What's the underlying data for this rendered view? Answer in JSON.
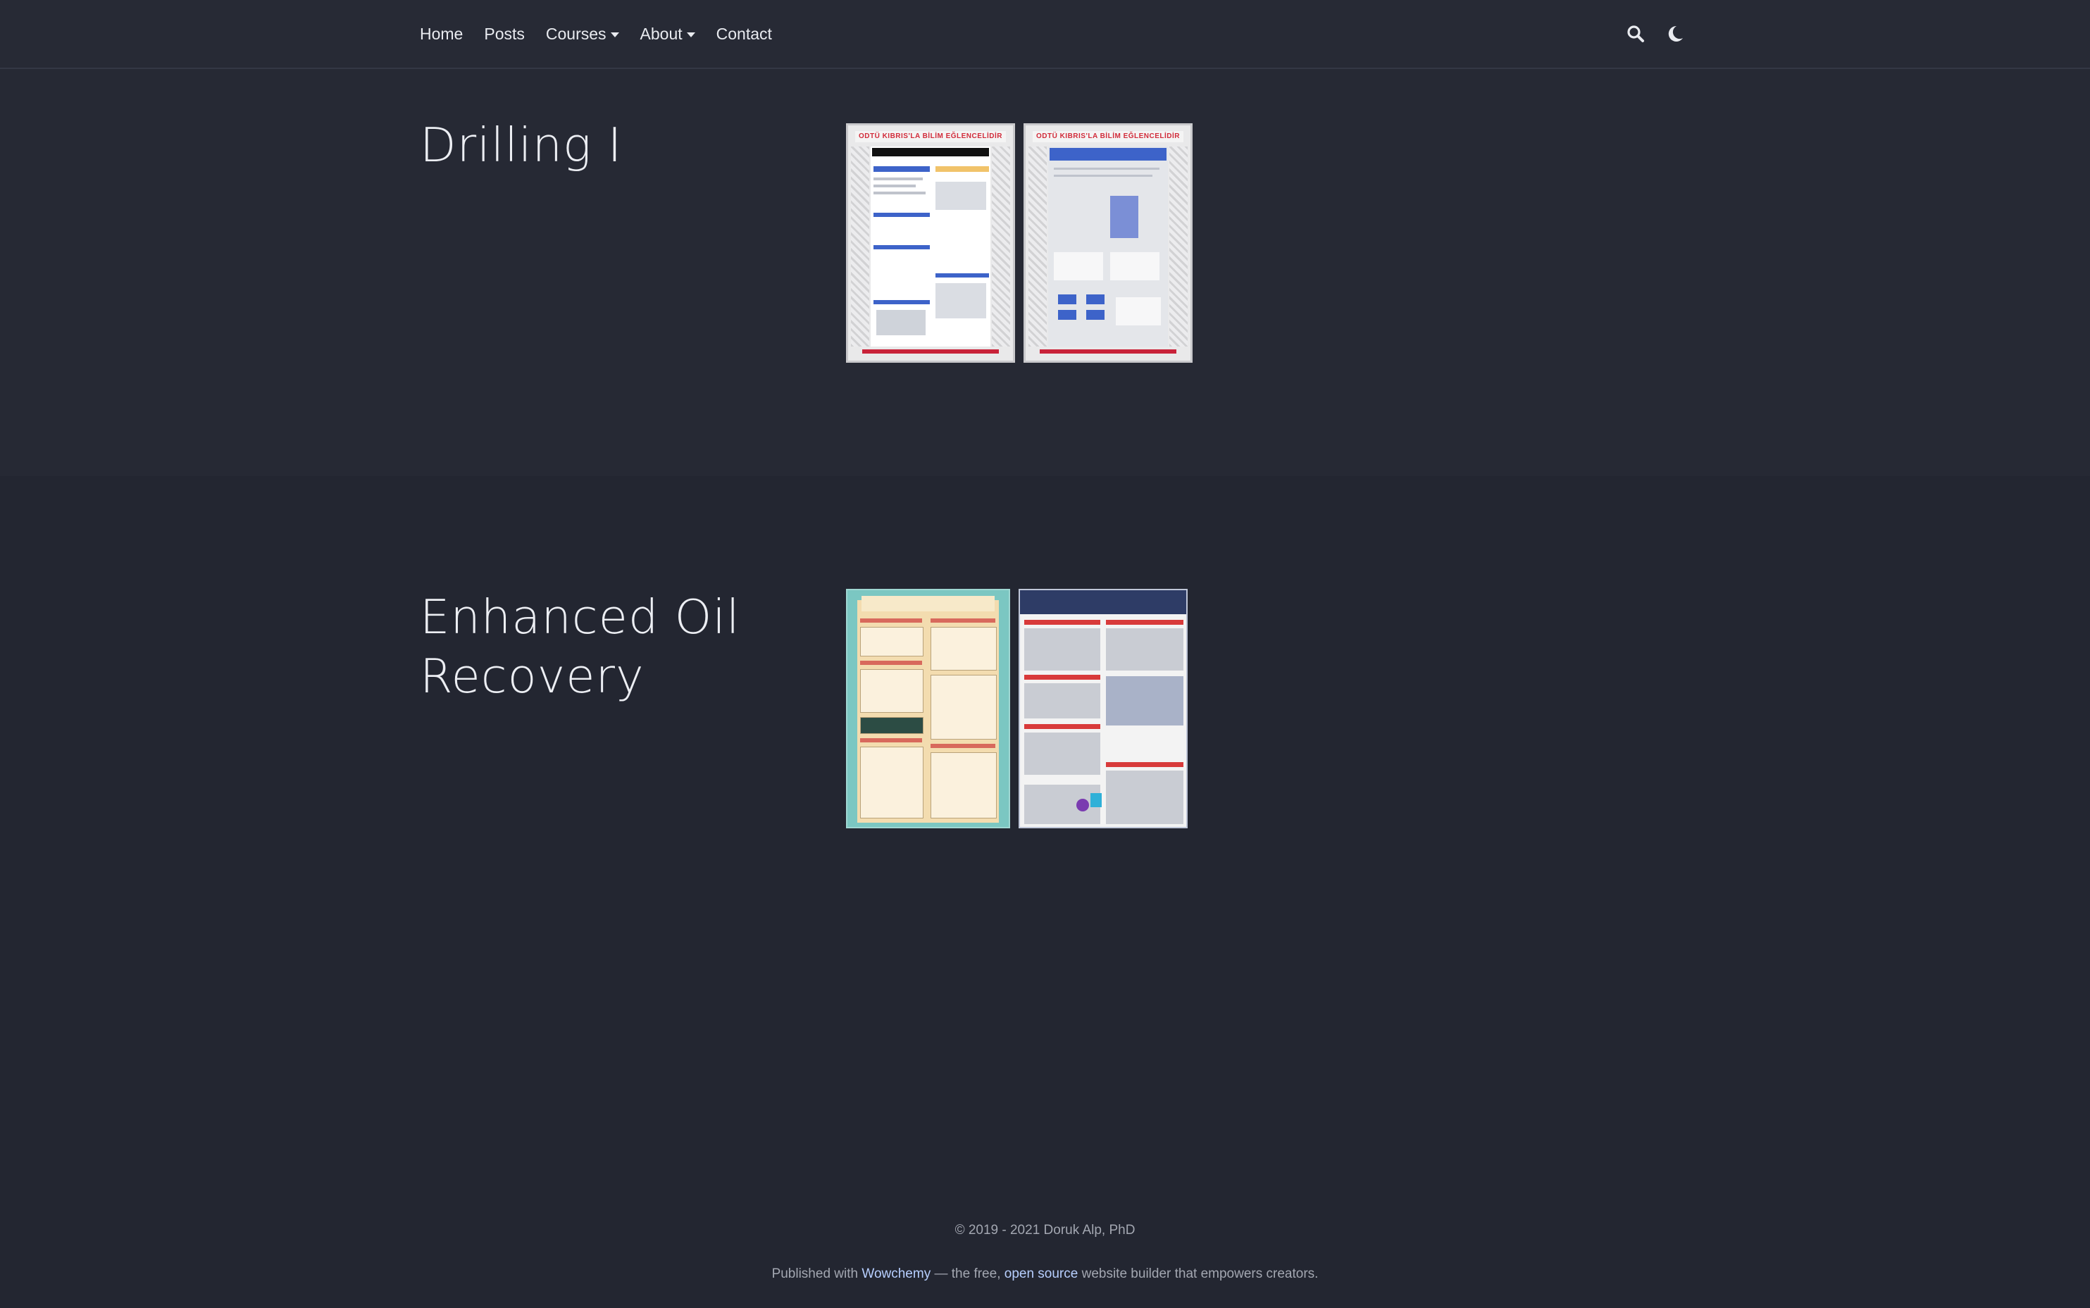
{
  "nav": {
    "items": [
      {
        "label": "Home",
        "dropdown": false
      },
      {
        "label": "Posts",
        "dropdown": false
      },
      {
        "label": "Courses",
        "dropdown": true
      },
      {
        "label": "About",
        "dropdown": true
      },
      {
        "label": "Contact",
        "dropdown": false
      }
    ],
    "icons": [
      "search-icon",
      "moon-icon"
    ]
  },
  "sections": [
    {
      "title": "Drilling I",
      "posters": [
        "drilling-poster-1",
        "drilling-poster-2"
      ]
    },
    {
      "title": "Enhanced Oil Recovery",
      "posters": [
        "eor-poster-1",
        "eor-poster-2"
      ]
    }
  ],
  "poster_text": {
    "drilling_header": "ODTÜ KIBRIS'LA BİLİM EĞLENCELİDİR"
  },
  "footer": {
    "copyright": "© 2019 - 2021 Doruk Alp, PhD",
    "powered_prefix": "Published with ",
    "powered_link1": "Wowchemy",
    "powered_middle": " — the free, ",
    "powered_link2": "open source",
    "powered_suffix": " website builder that empowers creators."
  },
  "colors": {
    "background": "#232631",
    "navbar": "#272a35",
    "link_accent": "#b7cfff"
  }
}
